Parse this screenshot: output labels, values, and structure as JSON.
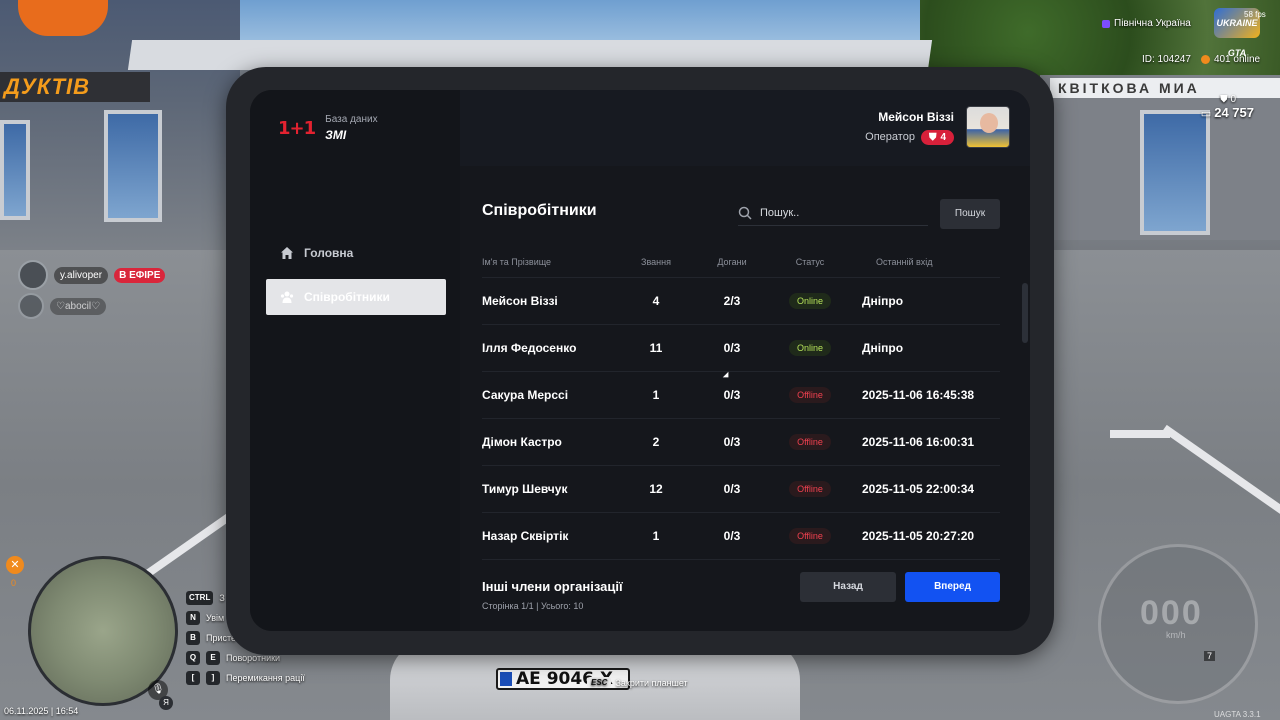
{
  "hud": {
    "region": "Північна Україна",
    "logo_text": "UKRAINE GTA",
    "fps": "58 fps",
    "player_id": "ID: 104247",
    "online": "401 online",
    "wanted_level": "0",
    "cash": "24 757",
    "date_time": "06.11.2025 | 16:54",
    "minimap_count": "0",
    "version": "UAGTA 3.3.1",
    "speed": "000",
    "speed_unit": "km/h",
    "gear": "7",
    "esc_key": "ESC",
    "esc_label": "Закрити планшет",
    "keys": [
      {
        "key": "CTRL",
        "label": "З"
      },
      {
        "key": "N",
        "label": "Увім"
      },
      {
        "key": "B",
        "label": "Присте"
      },
      {
        "key": "Q",
        "key2": "E",
        "label": "Поворотники"
      },
      {
        "key": "[",
        "key2": "]",
        "label": "Перемикання рації"
      }
    ],
    "live": {
      "user1": "y.alivoper",
      "badge": "В ЕФІРЕ",
      "user2": "♡aboсil♡"
    },
    "scene_signs": {
      "left": "ДУКТІВ",
      "right": "КВІТКОВА МИА",
      "plate": "AE 9046 X"
    }
  },
  "tablet": {
    "brand": {
      "logo": "1+1",
      "subtitle": "База даних",
      "title": "ЗМІ"
    },
    "nav": [
      {
        "label": "Головна",
        "icon": "home-icon",
        "active": false
      },
      {
        "label": "Співробітники",
        "icon": "users-icon",
        "active": true
      }
    ],
    "user": {
      "name": "Мейсон Віззі",
      "role": "Оператор",
      "rank": "4"
    },
    "page_title": "Співробітники",
    "search": {
      "placeholder": "Пошук..",
      "button": "Пошук"
    },
    "table": {
      "headers": [
        "Ім'я та Прізвище",
        "Звання",
        "Догани",
        "Статус",
        "Останній вхід"
      ],
      "rows": [
        {
          "name": "Мейсон Віззі",
          "rank": "4",
          "warnings": "2/3",
          "status": "Online",
          "last": "Дніпро"
        },
        {
          "name": "Ілля Федосенко",
          "rank": "11",
          "warnings": "0/3",
          "status": "Online",
          "last": "Дніпро"
        },
        {
          "name": "Сакура Мерссі",
          "rank": "1",
          "warnings": "0/3",
          "status": "Offline",
          "last": "2025-11-06 16:45:38"
        },
        {
          "name": "Дімон Кастро",
          "rank": "2",
          "warnings": "0/3",
          "status": "Offline",
          "last": "2025-11-06 16:00:31"
        },
        {
          "name": "Тимур Шевчук",
          "rank": "12",
          "warnings": "0/3",
          "status": "Offline",
          "last": "2025-11-05 22:00:34"
        },
        {
          "name": "Назар Сквіртік",
          "rank": "1",
          "warnings": "0/3",
          "status": "Offline",
          "last": "2025-11-05 20:27:20"
        }
      ]
    },
    "footer": {
      "title": "Інші члени організації",
      "pagination": "Сторінка 1/1 | Усього: 10",
      "back": "Назад",
      "next": "Вперед"
    },
    "colors": {
      "accent_blue": "#1252f2",
      "brand_red": "#e32230",
      "online": "#b7e35a",
      "offline": "#f0404f"
    }
  }
}
